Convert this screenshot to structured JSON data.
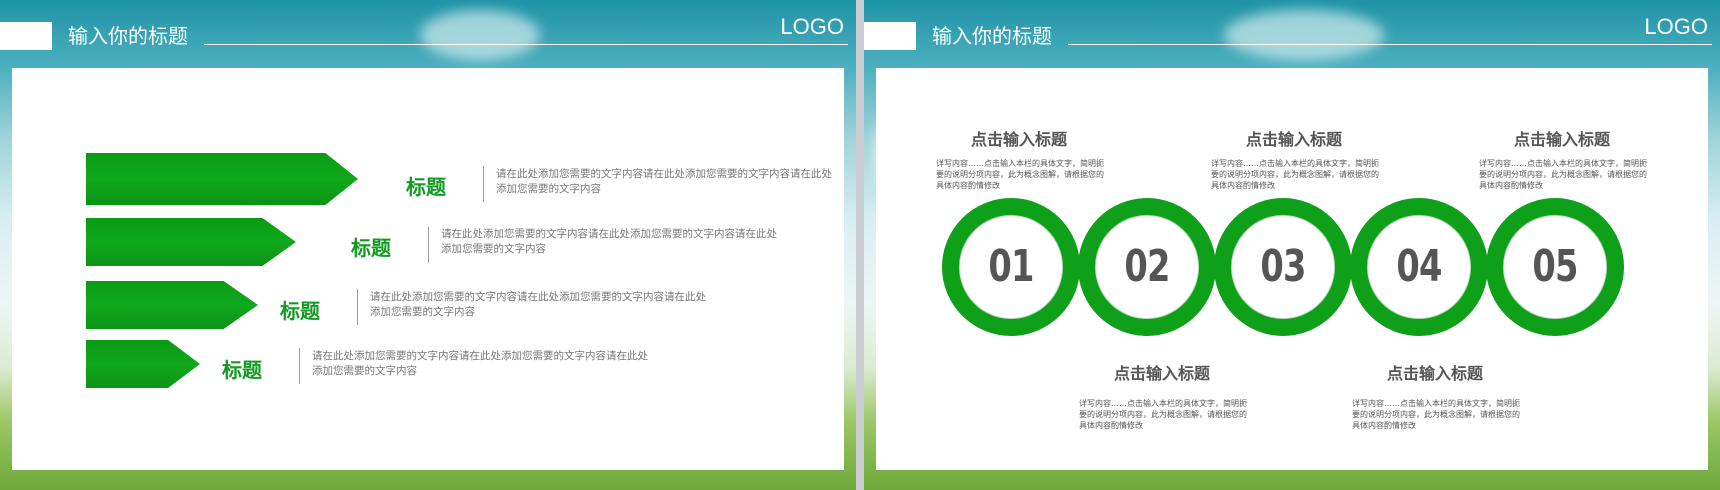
{
  "slides": [
    {
      "header_title": "输入你的标题",
      "logo": "LOGO",
      "items": [
        {
          "label": "标题",
          "desc": "请在此处添加您需要的文字内容请在此处添加您需要的文字内容请在此处添加您需要的文字内容"
        },
        {
          "label": "标题",
          "desc": "请在此处添加您需要的文字内容请在此处添加您需要的文字内容请在此处添加您需要的文字内容"
        },
        {
          "label": "标题",
          "desc": "请在此处添加您需要的文字内容请在此处添加您需要的文字内容请在此处添加您需要的文字内容"
        },
        {
          "label": "标题",
          "desc": "请在此处添加您需要的文字内容请在此处添加您需要的文字内容请在此处添加您需要的文字内容"
        }
      ]
    },
    {
      "header_title": "输入你的标题",
      "logo": "LOGO",
      "steps": [
        {
          "num": "01",
          "title": "点击输入标题",
          "desc": "详写内容……点击输入本栏的具体文字，简明扼要的说明分项内容，此为概念图解，请根据您的具体内容酌情修改"
        },
        {
          "num": "02",
          "title": "点击输入标题",
          "desc": "详写内容……点击输入本栏的具体文字，简明扼要的说明分项内容，此为概念图解，请根据您的具体内容酌情修改"
        },
        {
          "num": "03",
          "title": "点击输入标题",
          "desc": "详写内容……点击输入本栏的具体文字，简明扼要的说明分项内容，此为概念图解，请根据您的具体内容酌情修改"
        },
        {
          "num": "04",
          "title": "点击输入标题",
          "desc": "详写内容……点击输入本栏的具体文字，简明扼要的说明分项内容，此为概念图解，请根据您的具体内容酌情修改"
        },
        {
          "num": "05",
          "title": "点击输入标题",
          "desc": "详写内容……点击输入本栏的具体文字，简明扼要的说明分项内容，此为概念图解，请根据您的具体内容酌情修改"
        }
      ]
    }
  ],
  "colors": {
    "accent": "#0ea019",
    "label": "#129b22",
    "text": "#555555"
  }
}
